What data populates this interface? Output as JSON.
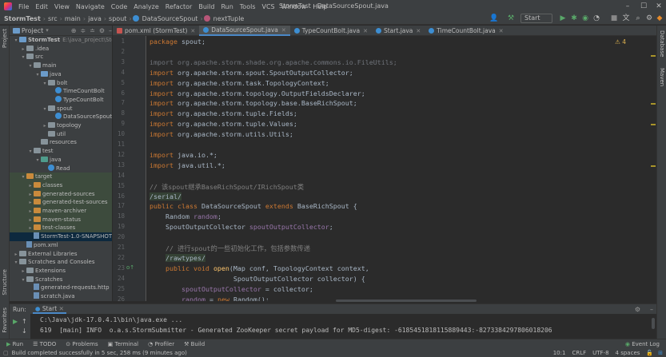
{
  "menu": {
    "items": [
      "File",
      "Edit",
      "View",
      "Navigate",
      "Code",
      "Analyze",
      "Refactor",
      "Build",
      "Run",
      "Tools",
      "VCS",
      "Window",
      "Help"
    ],
    "window_title": "StormTest - DataSourceSpout.java"
  },
  "navbar": {
    "crumbs": [
      "StormTest",
      "src",
      "main",
      "java",
      "spout",
      "DataSourceSpout",
      "nextTuple"
    ],
    "run_config": "Start"
  },
  "project_panel": {
    "title": "Project",
    "tree": [
      {
        "label": "StormTest",
        "extra": "E:\\java_project\\Storm",
        "depth": 0,
        "open": true,
        "type": "module"
      },
      {
        "label": ".idea",
        "depth": 1,
        "open": false,
        "type": "folder"
      },
      {
        "label": "src",
        "depth": 1,
        "open": true,
        "type": "folder"
      },
      {
        "label": "main",
        "depth": 2,
        "open": true,
        "type": "folder"
      },
      {
        "label": "java",
        "depth": 3,
        "open": true,
        "type": "src"
      },
      {
        "label": "bolt",
        "depth": 4,
        "open": true,
        "type": "folder"
      },
      {
        "label": "TimeCountBolt",
        "depth": 5,
        "type": "class"
      },
      {
        "label": "TypeCountBolt",
        "depth": 5,
        "type": "class"
      },
      {
        "label": "spout",
        "depth": 4,
        "open": true,
        "type": "folder"
      },
      {
        "label": "DataSourceSpout",
        "depth": 5,
        "type": "class"
      },
      {
        "label": "topology",
        "depth": 4,
        "open": false,
        "type": "folder"
      },
      {
        "label": "util",
        "depth": 4,
        "type": "folder"
      },
      {
        "label": "resources",
        "depth": 3,
        "type": "folder"
      },
      {
        "label": "test",
        "depth": 2,
        "open": true,
        "type": "folder"
      },
      {
        "label": "java",
        "depth": 3,
        "open": true,
        "type": "test"
      },
      {
        "label": "Read",
        "depth": 4,
        "type": "class"
      },
      {
        "label": "target",
        "depth": 1,
        "open": true,
        "type": "target"
      },
      {
        "label": "classes",
        "depth": 2,
        "open": false,
        "type": "target"
      },
      {
        "label": "generated-sources",
        "depth": 2,
        "open": false,
        "type": "target"
      },
      {
        "label": "generated-test-sources",
        "depth": 2,
        "open": false,
        "type": "target"
      },
      {
        "label": "maven-archiver",
        "depth": 2,
        "open": false,
        "type": "target"
      },
      {
        "label": "maven-status",
        "depth": 2,
        "open": false,
        "type": "target"
      },
      {
        "label": "test-classes",
        "depth": 2,
        "open": false,
        "type": "target"
      },
      {
        "label": "StormTest-1.0-SNAPSHOT.jar",
        "depth": 2,
        "type": "jar"
      },
      {
        "label": "pom.xml",
        "depth": 1,
        "type": "file"
      },
      {
        "label": "External Libraries",
        "depth": 0,
        "open": false,
        "type": "lib"
      },
      {
        "label": "Scratches and Consoles",
        "depth": 0,
        "open": true,
        "type": "lib"
      },
      {
        "label": "Extensions",
        "depth": 1,
        "open": false,
        "type": "folder"
      },
      {
        "label": "Scratches",
        "depth": 1,
        "open": true,
        "type": "folder"
      },
      {
        "label": "generated-requests.http",
        "depth": 2,
        "type": "file"
      },
      {
        "label": "scratch.java",
        "depth": 2,
        "type": "file"
      }
    ]
  },
  "tabs": [
    {
      "label": "pom.xml (StormTest)",
      "active": false
    },
    {
      "label": "DataSourceSpout.java",
      "active": true
    },
    {
      "label": "TypeCountBolt.java",
      "active": false
    },
    {
      "label": "Start.java",
      "active": false
    },
    {
      "label": "TimeCountBolt.java",
      "active": false
    }
  ],
  "editor": {
    "warnings": "4",
    "lines": [
      {
        "n": "1",
        "html": "<span class=\"kw\">package</span> spout;"
      },
      {
        "n": "2",
        "html": ""
      },
      {
        "n": "3",
        "html": "<span class=\"ghost\">import org.apache.storm.shade.org.apache.commons.io.FileUtils;</span>"
      },
      {
        "n": "4",
        "html": "<span class=\"kw\">import</span> org.apache.storm.spout.SpoutOutputCollector;"
      },
      {
        "n": "5",
        "html": "<span class=\"kw\">import</span> org.apache.storm.task.TopologyContext;"
      },
      {
        "n": "6",
        "html": "<span class=\"kw\">import</span> org.apache.storm.topology.OutputFieldsDeclarer;"
      },
      {
        "n": "7",
        "html": "<span class=\"kw\">import</span> org.apache.storm.topology.base.BaseRichSpout;"
      },
      {
        "n": "8",
        "html": "<span class=\"kw\">import</span> org.apache.storm.tuple.Fields;"
      },
      {
        "n": "9",
        "html": "<span class=\"kw\">import</span> org.apache.storm.tuple.Values;"
      },
      {
        "n": "10",
        "html": "<span class=\"kw\">import</span> org.apache.storm.utils.Utils;"
      },
      {
        "n": "11",
        "html": ""
      },
      {
        "n": "12",
        "html": "<span class=\"kw\">import</span> java.io.*;"
      },
      {
        "n": "13",
        "html": "<span class=\"kw\">import</span> java.util.*;"
      },
      {
        "n": "14",
        "html": ""
      },
      {
        "n": "15",
        "html": "<span class=\"cm\">// 该spout继承BaseRichSpout/IRichSpout类</span>"
      },
      {
        "n": "16",
        "html": "<span class=\"hlbox cm\">/serial/</span>"
      },
      {
        "n": "17",
        "html": "<span class=\"kw\">public class</span> DataSourceSpout <span class=\"kw\">extends</span> BaseRichSpout {"
      },
      {
        "n": "18",
        "html": "    Random <span class=\"fld\">random</span>;"
      },
      {
        "n": "19",
        "html": "    SpoutOutputCollector <span class=\"fld\">spoutOutputCollector</span>;"
      },
      {
        "n": "20",
        "html": ""
      },
      {
        "n": "21",
        "html": "    <span class=\"cm\">// 进行spout的一些初始化工作，包括参数传递</span>"
      },
      {
        "n": "22",
        "html": "    <span class=\"hlbox cm\">/rawtypes/</span>"
      },
      {
        "n": "23",
        "html": "    <span class=\"kw\">public void</span> <span class=\"fn\">open</span>(Map conf, TopologyContext context,"
      },
      {
        "n": "24",
        "html": "                     SpoutOutputCollector collector) {"
      },
      {
        "n": "25",
        "html": "        <span class=\"fld\">spoutOutputCollector</span> = collector;"
      },
      {
        "n": "26",
        "html": "        <span class=\"fld\">random</span> = <span class=\"kw\">new</span> Random();"
      }
    ]
  },
  "run_panel": {
    "label": "Run:",
    "tab": "Start",
    "lines": [
      "C:\\Java\\jdk-17.0.4.1\\bin\\java.exe ...",
      "619  [main] INFO  o.a.s.StormSubmitter - Generated ZooKeeper secret payload for MD5-digest: -6185451818115889443:-8273384297806018206"
    ]
  },
  "bottom_tools": [
    "Run",
    "TODO",
    "Problems",
    "Terminal",
    "Profiler",
    "Build"
  ],
  "event_log": "Event Log",
  "status": {
    "message": "Build completed successfully in 5 sec, 258 ms (9 minutes ago)",
    "position": "10:1",
    "line_sep": "CRLF",
    "encoding": "UTF-8",
    "indent": "4 spaces"
  },
  "stripes": {
    "left": [
      "Project",
      "Structure",
      "Favorites"
    ],
    "right": [
      "Database",
      "Maven"
    ]
  }
}
